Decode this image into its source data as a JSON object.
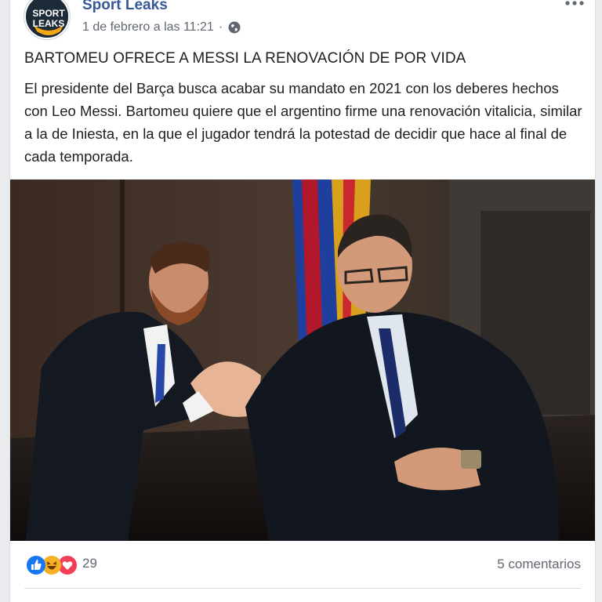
{
  "post": {
    "page_name": "Sport Leaks",
    "timestamp": "1 de febrero a las 11:21",
    "separator": "·",
    "avatar_text": [
      "SPORT",
      "LEAKS"
    ],
    "privacy_icon": "globe-icon",
    "menu_icon": "more-options-icon",
    "headline": "BARTOMEU OFRECE A MESSI LA RENOVACIÓN DE POR VIDA",
    "body": "El presidente del Barça busca acabar su mandato en 2021 con los deberes hechos con Leo Messi. Bartomeu quiere que el argentino firme una renovación vitalicia, similar a la de Iniesta, en la que el jugador tendrá la potestad de decidir que hace al final de cada temporada.",
    "photo_alt": "Messi and Bartomeu shaking hands"
  },
  "footer": {
    "reaction_icons": [
      "like-icon",
      "haha-icon",
      "love-icon"
    ],
    "reaction_count": "29",
    "comments": "5 comentarios"
  },
  "colors": {
    "link": "#385898",
    "meta": "#606770",
    "like": "#1877f2",
    "love": "#f33e58",
    "haha": "#f7b125"
  }
}
